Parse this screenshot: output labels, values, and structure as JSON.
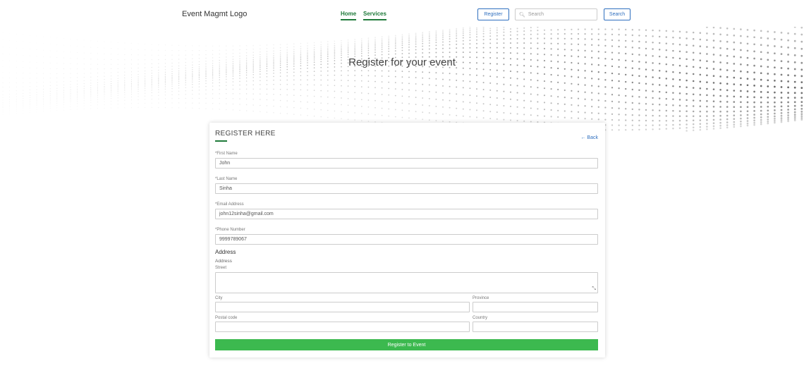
{
  "header": {
    "logo": "Event Magmt Logo",
    "nav": [
      {
        "label": "Home"
      },
      {
        "label": "Services"
      }
    ],
    "register_label": "Register",
    "search_placeholder": "Search",
    "search_button_label": "Search"
  },
  "hero": {
    "title": "Register for your event"
  },
  "form": {
    "title": "REGISTER HERE",
    "back_label": "← Back",
    "first_name": {
      "label": "*First Name",
      "value": "John"
    },
    "last_name": {
      "label": "*Last Name",
      "value": "Sinha"
    },
    "email": {
      "label": "*Email Address",
      "value": "john12sinha@gmail.com"
    },
    "phone": {
      "label": "*Phone Number",
      "value": "9999789067"
    },
    "address_heading": "Address",
    "address_sublabel": "Address",
    "street": {
      "label": "Street",
      "value": ""
    },
    "city": {
      "label": "City",
      "value": ""
    },
    "province": {
      "label": "Province",
      "value": ""
    },
    "postal_code": {
      "label": "Postal code",
      "value": ""
    },
    "country": {
      "label": "Country",
      "value": ""
    },
    "submit_label": "Register to Event"
  },
  "colors": {
    "accent_green": "#1f7a3a",
    "button_green": "#3cb94f",
    "link_blue": "#2f6fbf"
  }
}
